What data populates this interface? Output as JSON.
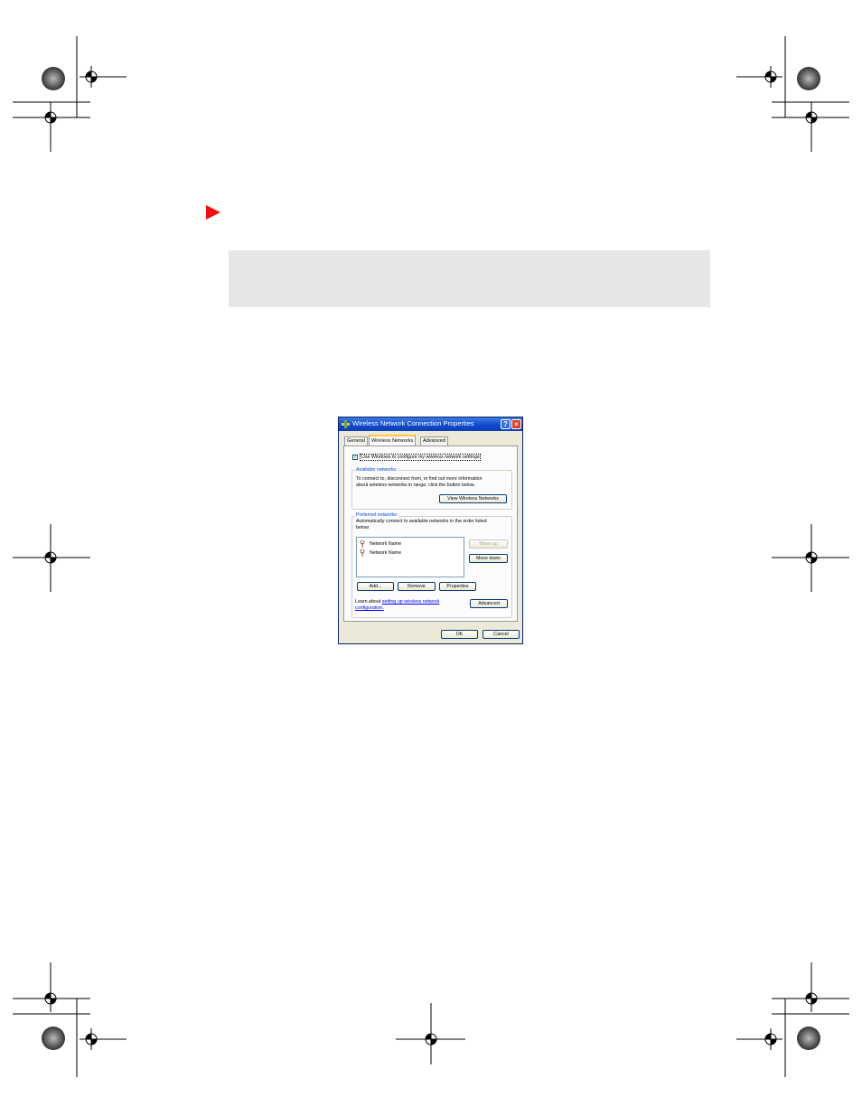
{
  "dialog": {
    "title": "Wireless Network Connection Properties",
    "help_glyph": "?",
    "close_glyph": "×",
    "tabs": [
      {
        "label": "General"
      },
      {
        "label": "Wireless Networks"
      },
      {
        "label": "Advanced"
      }
    ],
    "use_windows_checkbox": {
      "label": "Use Windows to configure my wireless network settings",
      "checked": true,
      "check_glyph": "✓"
    },
    "available": {
      "group_label": "Available networks:",
      "line1": "To connect to, disconnect from, or find out more information",
      "line2": "about wireless networks in range, click the button below.",
      "view_button": "View Wireless Networks"
    },
    "preferred": {
      "group_label": "Preferred networks:",
      "line1": "Automatically connect to available networks in the order listed",
      "line2": "below:",
      "networks": [
        {
          "name": "Network Name",
          "icon": "wireless-network-icon"
        },
        {
          "name": "Network Name",
          "icon": "wireless-network-icon"
        }
      ],
      "move_up": "Move up",
      "move_down": "Move down",
      "add": "Add...",
      "remove": "Remove",
      "properties": "Properties",
      "learn_prefix": "Learn about",
      "learn_link_1": "setting up wireless network",
      "learn_link_2": "configuration.",
      "advanced": "Advanced"
    },
    "ok": "OK",
    "cancel": "Cancel"
  },
  "colors": {
    "pointer": "#ee1111",
    "gray_bar": "#e6e6e6",
    "title_bar": "#1048c8",
    "dialog_face": "#ece9d8",
    "group_label": "#0046d5"
  }
}
